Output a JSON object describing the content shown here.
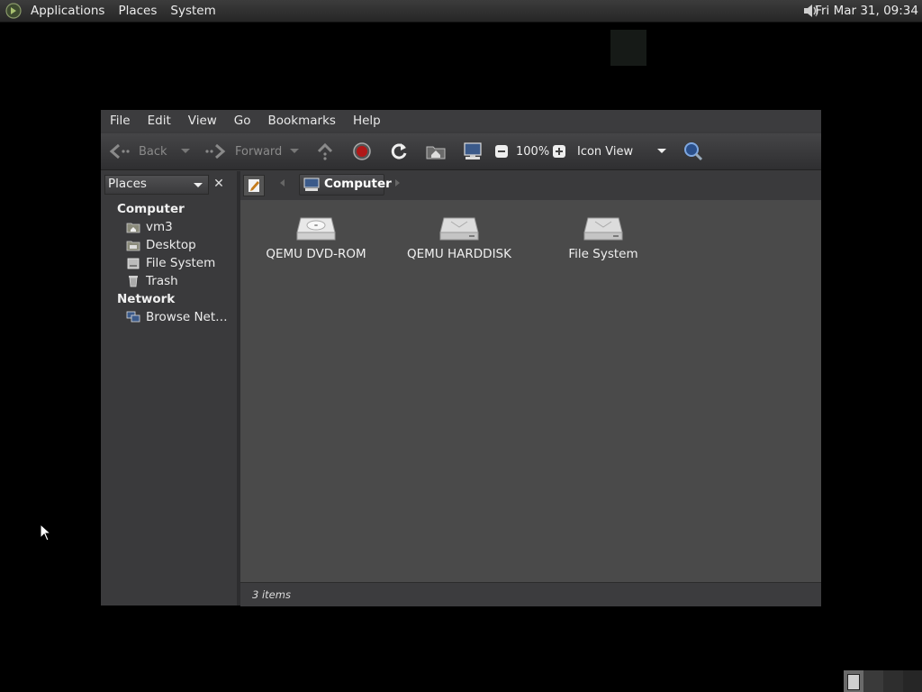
{
  "top_panel": {
    "menu": [
      "Applications",
      "Places",
      "System"
    ],
    "clock": "Fri Mar 31, 09:34"
  },
  "window": {
    "menubar": [
      "File",
      "Edit",
      "View",
      "Go",
      "Bookmarks",
      "Help"
    ],
    "toolbar": {
      "back_label": "Back",
      "forward_label": "Forward",
      "zoom": "100%",
      "view_mode": "Icon View"
    },
    "sidebar": {
      "selector": "Places",
      "sections": [
        {
          "heading": "Computer",
          "items": [
            "vm3",
            "Desktop",
            "File System",
            "Trash"
          ]
        },
        {
          "heading": "Network",
          "items": [
            "Browse Net…"
          ]
        }
      ]
    },
    "path_bar": {
      "current": "Computer"
    },
    "content": {
      "items": [
        {
          "label": "QEMU DVD-ROM",
          "icon": "optical-drive-icon"
        },
        {
          "label": "QEMU HARDDISK",
          "icon": "harddisk-icon"
        },
        {
          "label": "File System",
          "icon": "harddisk-icon"
        }
      ]
    },
    "status": "3 items"
  }
}
